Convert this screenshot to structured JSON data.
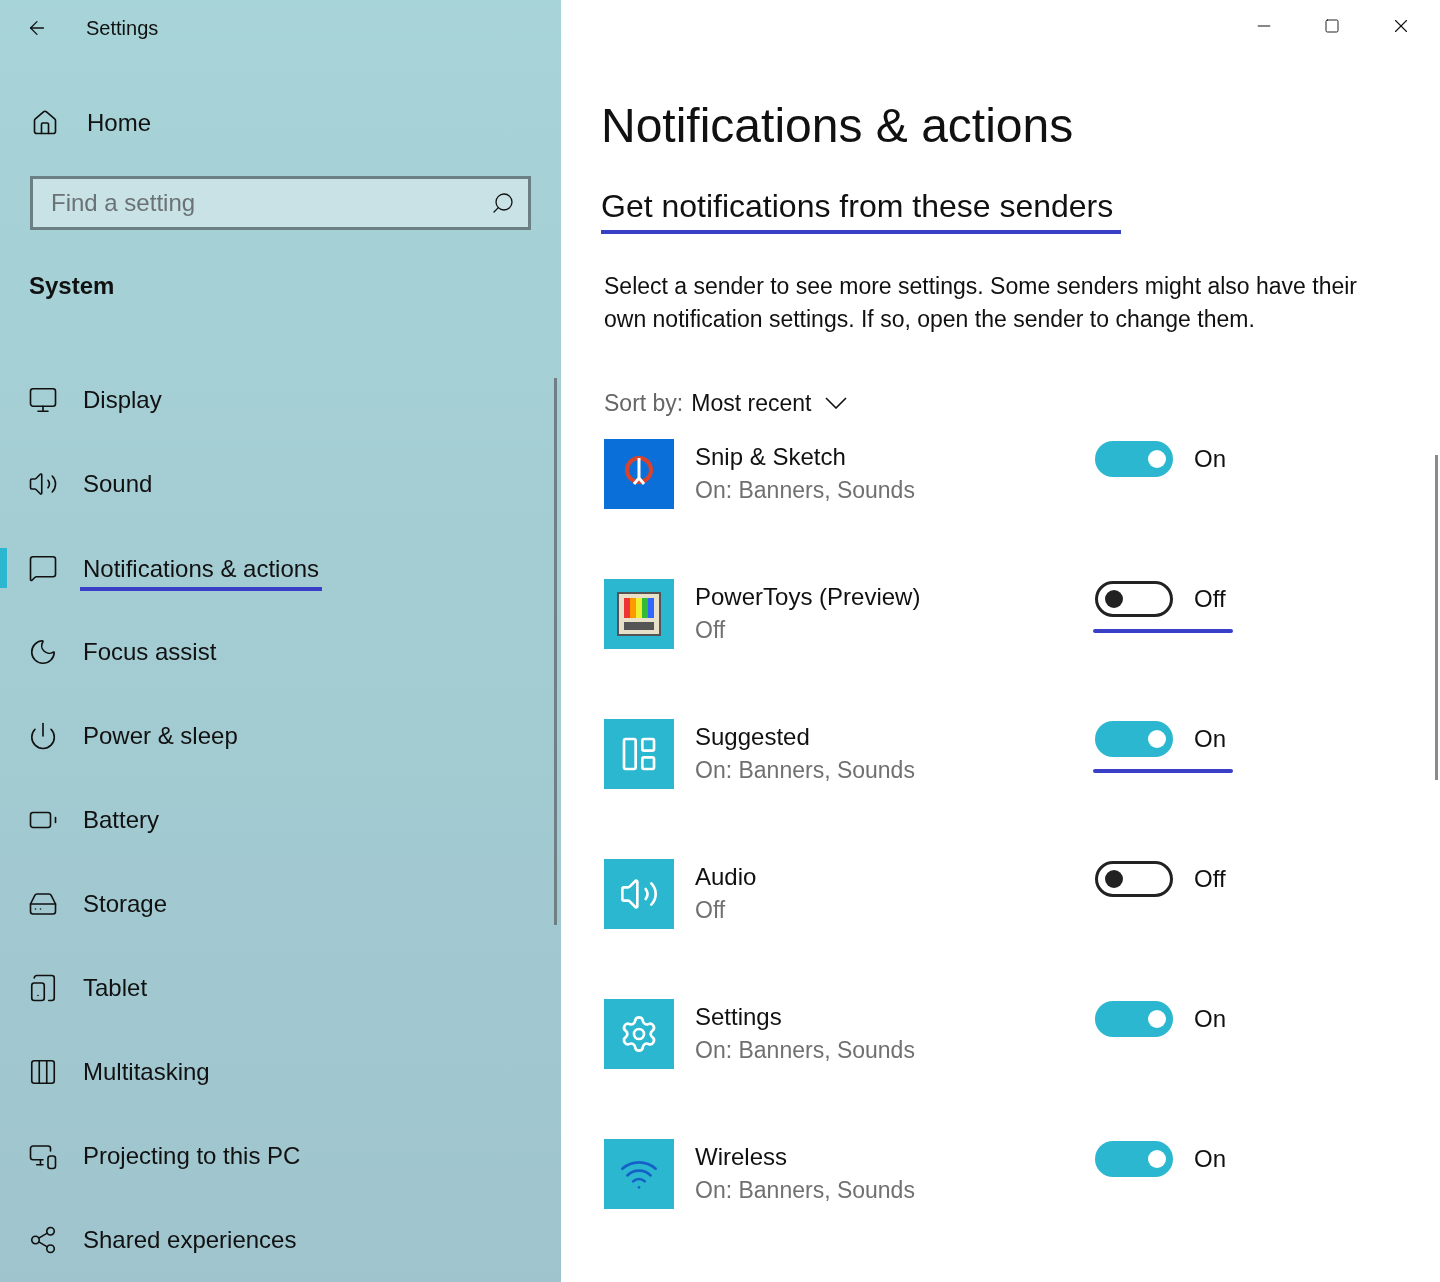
{
  "window": {
    "title": "Settings"
  },
  "sidebar": {
    "home": "Home",
    "search": {
      "placeholder": "Find a setting"
    },
    "section": "System",
    "items": [
      {
        "label": "Display",
        "selected": false
      },
      {
        "label": "Sound",
        "selected": false
      },
      {
        "label": "Notifications & actions",
        "selected": true
      },
      {
        "label": "Focus assist",
        "selected": false
      },
      {
        "label": "Power & sleep",
        "selected": false
      },
      {
        "label": "Battery",
        "selected": false
      },
      {
        "label": "Storage",
        "selected": false
      },
      {
        "label": "Tablet",
        "selected": false
      },
      {
        "label": "Multitasking",
        "selected": false
      },
      {
        "label": "Projecting to this PC",
        "selected": false
      },
      {
        "label": "Shared experiences",
        "selected": false
      }
    ]
  },
  "main": {
    "title": "Notifications & actions",
    "heading": {
      "text": "Get notifications from these senders",
      "underlined": true
    },
    "description": "Select a sender to see more settings. Some senders might also have their own notification settings. If so, open the sender to change them.",
    "sort": {
      "label": "Sort by:",
      "value": "Most recent"
    },
    "senders": [
      {
        "name": "Snip & Sketch",
        "status": "On: Banners, Sounds",
        "on": true,
        "toggle_label": "On",
        "highlighted": false
      },
      {
        "name": "PowerToys (Preview)",
        "status": "Off",
        "on": false,
        "toggle_label": "Off",
        "highlighted": true
      },
      {
        "name": "Suggested",
        "status": "On: Banners, Sounds",
        "on": true,
        "toggle_label": "On",
        "highlighted": true
      },
      {
        "name": "Audio",
        "status": "Off",
        "on": false,
        "toggle_label": "Off",
        "highlighted": false
      },
      {
        "name": "Settings",
        "status": "On: Banners, Sounds",
        "on": true,
        "toggle_label": "On",
        "highlighted": false
      },
      {
        "name": "Wireless",
        "status": "On: Banners, Sounds",
        "on": true,
        "toggle_label": "On",
        "highlighted": false
      }
    ]
  }
}
